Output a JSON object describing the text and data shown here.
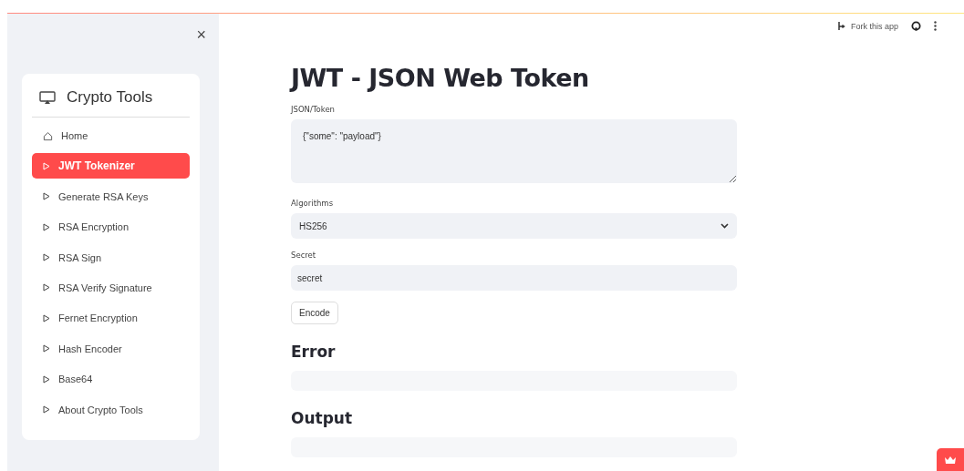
{
  "sidebar": {
    "close": "×",
    "title": "Crypto Tools",
    "items": [
      {
        "label": "Home",
        "kind": "home",
        "selected": false
      },
      {
        "label": "JWT Tokenizer",
        "kind": "page",
        "selected": true
      },
      {
        "label": "Generate RSA Keys",
        "kind": "page",
        "selected": false
      },
      {
        "label": "RSA Encryption",
        "kind": "page",
        "selected": false
      },
      {
        "label": "RSA Sign",
        "kind": "page",
        "selected": false
      },
      {
        "label": "RSA Verify Signature",
        "kind": "page",
        "selected": false
      },
      {
        "label": "Fernet Encryption",
        "kind": "page",
        "selected": false
      },
      {
        "label": "Hash Encoder",
        "kind": "page",
        "selected": false
      },
      {
        "label": "Base64",
        "kind": "page",
        "selected": false
      },
      {
        "label": "About Crypto Tools",
        "kind": "page",
        "selected": false
      }
    ]
  },
  "toolbar": {
    "fork": "Fork this app"
  },
  "main": {
    "title": "JWT - JSON Web Token",
    "token": {
      "label": "JSON/Token",
      "value": "{\"some\": \"payload\"}"
    },
    "algorithm": {
      "label": "Algorithms",
      "value": "HS256"
    },
    "secret": {
      "label": "Secret",
      "value": "secret"
    },
    "button": "Encode",
    "sections": [
      {
        "heading": "Error"
      },
      {
        "heading": "Output"
      }
    ]
  }
}
